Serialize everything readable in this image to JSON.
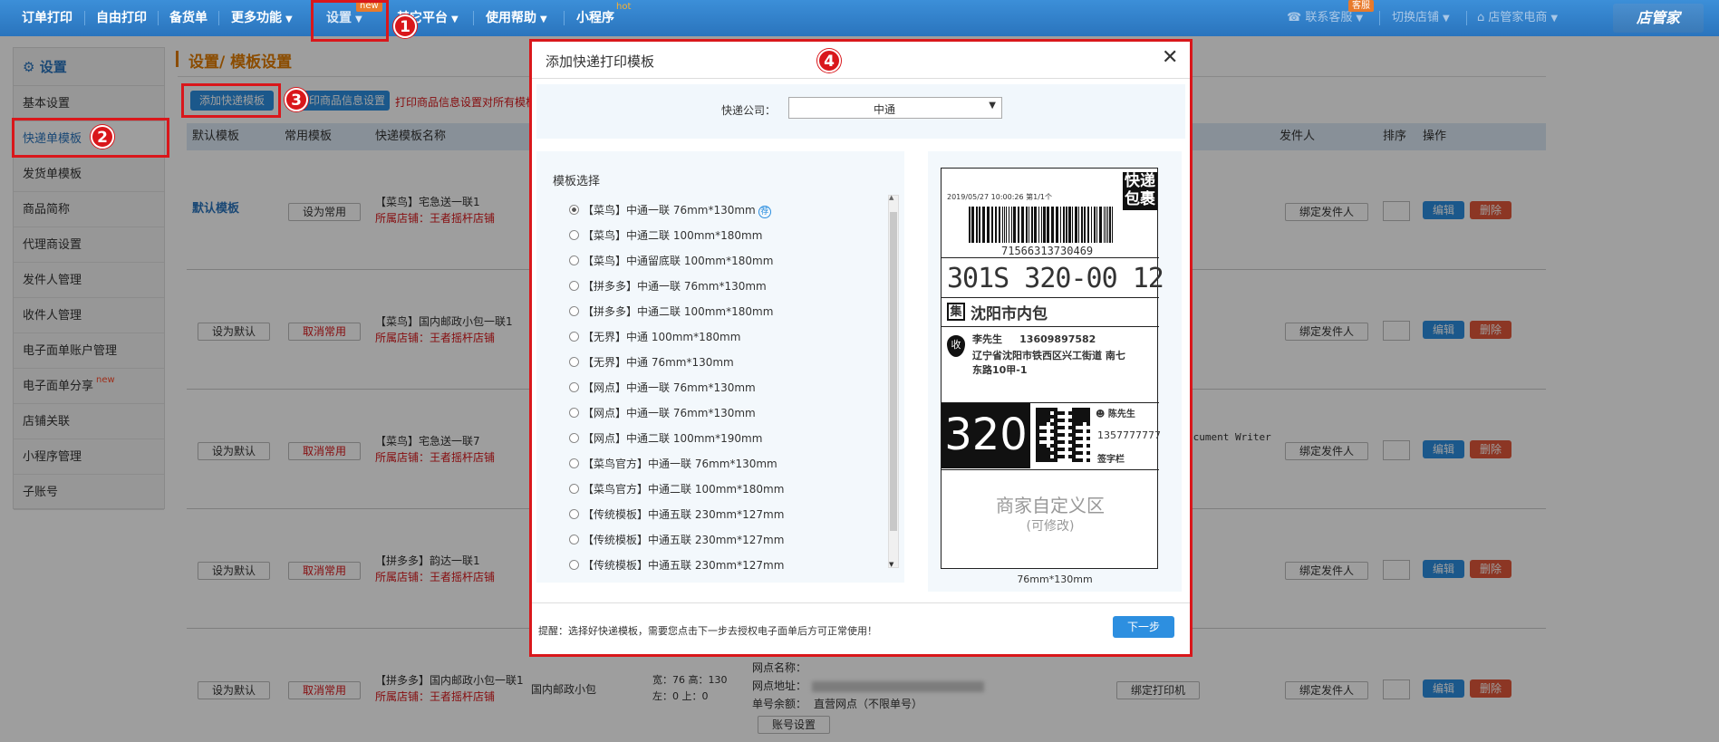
{
  "topnav": {
    "items": [
      "订单打印",
      "自由打印",
      "备货单",
      "更多功能",
      "设置",
      "其它平台",
      "使用帮助",
      "小程序"
    ],
    "new_badge": "new",
    "hot_badge": "hot",
    "right": {
      "service": "联系客服",
      "service_badge": "客服",
      "switch_shop": "切换店铺",
      "shop_name": "店管家电商",
      "brand": "店管家"
    }
  },
  "sidebar": {
    "title": "设置",
    "items": [
      "基本设置",
      "快递单模板",
      "发货单模板",
      "商品简称",
      "代理商设置",
      "发件人管理",
      "收件人管理",
      "电子面单账户管理",
      "电子面单分享",
      "店铺关联",
      "小程序管理",
      "子账号"
    ],
    "share_badge": "new"
  },
  "page": {
    "breadcrumb": "设置/ 模板设置",
    "add_template": "添加快递模板",
    "product_info": "打印商品信息设置",
    "notice": "打印商品信息设置对所有模板"
  },
  "table": {
    "headers": [
      "默认模板",
      "常用模板",
      "快递模板名称",
      "发件人",
      "排序",
      "操作"
    ],
    "bind_sender": "绑定发件人",
    "edit": "编辑",
    "delete": "删除",
    "set_default": "设为默认",
    "set_common": "设为常用",
    "cancel_common": "取消常用",
    "default_label": "默认模板",
    "shop_prefix": "所属店铺：王者摇杆店铺",
    "rows": [
      {
        "name": "【菜鸟】宅急送一联1"
      },
      {
        "name": "【菜鸟】国内邮政小包一联1"
      },
      {
        "name": "【菜鸟】宅急送一联7"
      },
      {
        "name": "【拼多多】韵达一联1"
      },
      {
        "name": "【拼多多】国内邮政小包一联1"
      }
    ],
    "last_row": {
      "type": "国内邮政小包",
      "size1": "宽：76  高：130",
      "size2": "左：0  上：0",
      "outlet_name": "网点名称：",
      "outlet_addr": "网点地址：",
      "balance_label": "单号余额：",
      "balance_value": "直营网点（不限单号）",
      "account_btn": "账号设置",
      "bind_printer": "绑定打印机"
    },
    "writer_snippet": "ocument Writer"
  },
  "modal": {
    "title": "添加快递打印模板",
    "company_label": "快递公司：",
    "company_value": "中通",
    "template_label": "模板选择",
    "templates": [
      "【菜鸟】中通一联 76mm*130mm",
      "【菜鸟】中通二联 100mm*180mm",
      "【菜鸟】中通留底联 100mm*180mm",
      "【拼多多】中通一联 76mm*130mm",
      "【拼多多】中通二联 100mm*180mm",
      "【无界】中通 100mm*180mm",
      "【无界】中通 76mm*130mm",
      "【网点】中通一联 76mm*130mm",
      "【网点】中通一联 76mm*130mm",
      "【网点】中通二联 100mm*190mm",
      "【菜鸟官方】中通一联 76mm*130mm",
      "【菜鸟官方】中通二联 100mm*180mm",
      "【传统模板】中通五联 230mm*127mm",
      "【传统模板】中通五联 230mm*127mm",
      "【传统模板】中通五联 230mm*127mm"
    ],
    "recommend_badge": "荐",
    "preview": {
      "date": "2019/05/27   10:00:26   第1/1个",
      "tag": "快递\n包裹",
      "barcode_number": "71566313730469",
      "sort_code": "301S 320-00 12",
      "ji_mark": "集",
      "dest": "沈阳市内包",
      "shou_mark": "收",
      "receiver": "李先生     13609897582",
      "addr1": "辽宁省沈阳市铁西区兴工街道 南七",
      "addr2": "东路10甲-1",
      "big_num": "320",
      "sender": "陈先生",
      "sender_phone": "1357777777",
      "sign": "签字栏",
      "custom": "商家自定义区",
      "custom_sub": "(可修改)",
      "size": "76mm*130mm"
    },
    "tip": "提醒：选择好快递模板，需要您点击下一步去授权电子面单后方可正常使用！",
    "next": "下一步"
  },
  "markers": [
    "1",
    "2",
    "3",
    "4"
  ]
}
